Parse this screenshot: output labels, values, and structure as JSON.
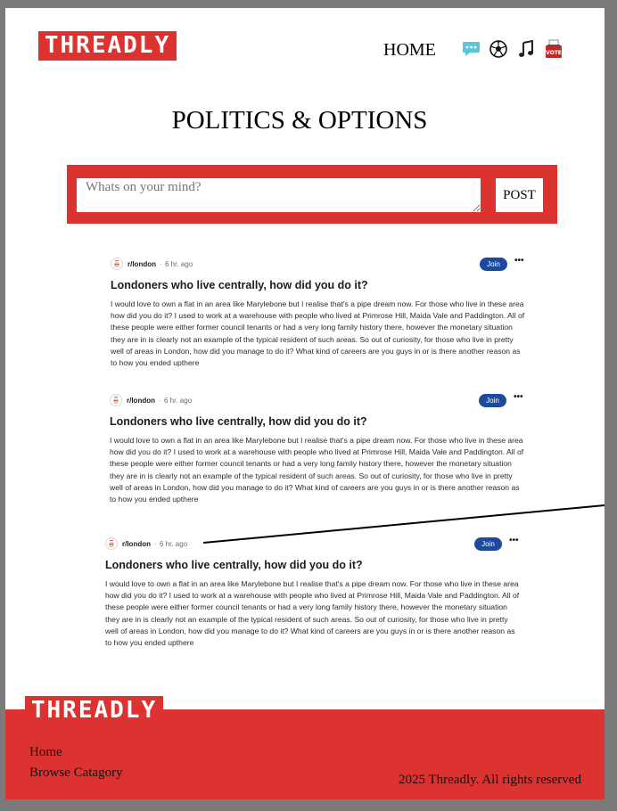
{
  "header": {
    "logo": "THREADLY",
    "nav_home": "HOME",
    "icons": [
      "chat-icon",
      "soccer-ball-icon",
      "music-note-icon",
      "vote-icon"
    ],
    "vote_label": "VOTE"
  },
  "page_title": "POLITICS & OPTIONS",
  "composer": {
    "placeholder": "Whats on your mind?",
    "post_label": "POST"
  },
  "posts": [
    {
      "subreddit": "r/london",
      "time": "6 hr. ago",
      "join_label": "Join",
      "more_label": "•••",
      "title": "Londoners who live centrally, how did you do it?",
      "body": "I would love to own a flat in an area like Marylebone but I realise that's a pipe dream now. For those who live in these area how did you do it? I used to work at a warehouse with people who lived at Primrose Hill, Maida Vale and Paddington. All of these people were either former council tenants or had a very long family history there, however the monetary situation they are in is clearly not an example of the typical resident of such areas. So out of curiosity, for those who live in pretty well of areas in London, how did you manage to do it? What kind of careers are you guys in or is there another reason as to how you ended upthere"
    },
    {
      "subreddit": "r/london",
      "time": "6 hr. ago",
      "join_label": "Join",
      "more_label": "•••",
      "title": "Londoners who live centrally, how did you do it?",
      "body": "I would love to own a flat in an area like Marylebone but I realise that's a pipe dream now. For those who live in these area how did you do it? I used to work at a warehouse with people who lived at Primrose Hill, Maida Vale and Paddington. All of these people were either former council tenants or had a very long family history there, however the monetary situation they are in is clearly not an example of the typical resident of such areas. So out of curiosity, for those who live in pretty well of areas in London, how did you manage to do it? What kind of careers are you guys in or is there another reason as to how you ended upthere"
    },
    {
      "subreddit": "r/london",
      "time": "6 hr. ago",
      "join_label": "Join",
      "more_label": "•••",
      "title": "Londoners who live centrally, how did you do it?",
      "body": "I would love to own a flat in an area like Marylebone but I realise that's a pipe dream now. For those who live in these area how did you do it? I used to work at a warehouse with people who lived at Primrose Hill, Maida Vale and Paddington. All of these people were either former council tenants or had a very long family history there, however the monetary situation they are in is clearly not an example of the typical resident of such areas. So out of curiosity, for those who live in pretty well of areas in London, how did you manage to do it? What kind of careers are you guys in or is there another reason as to how you ended upthere"
    }
  ],
  "footer": {
    "logo": "THREADLY",
    "links": [
      "Home",
      "Browse Catagory"
    ],
    "copyright": "2025 Threadly. All rights reserved"
  },
  "colors": {
    "brand_red": "#dc3330",
    "join_blue": "#1d4a9c",
    "backdrop_gray": "#7a7a7a"
  }
}
